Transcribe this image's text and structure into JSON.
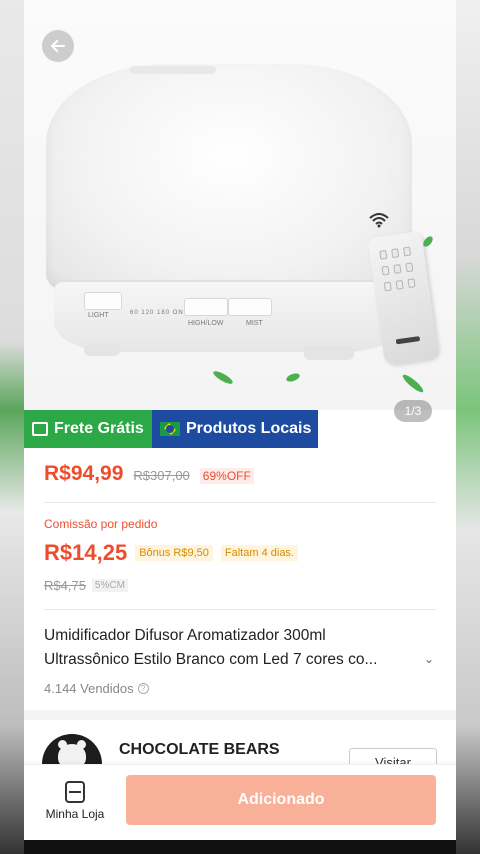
{
  "hero": {
    "back_icon": "arrow-left-icon",
    "pager": "1/3",
    "product_labels": {
      "light": "LIGHT",
      "timer": "60 120 180 ON",
      "high_low": "HIGH/LOW",
      "mist": "MIST"
    }
  },
  "badges": {
    "frete": "Frete Grátis",
    "local": "Produtos Locais"
  },
  "pricing": {
    "price": "R$94,99",
    "old_price": "R$307,00",
    "discount": "69%OFF"
  },
  "commission": {
    "label": "Comissão por pedido",
    "value": "R$14,25",
    "bonus": "Bônus R$9,50",
    "deadline": "Faltam 4 dias.",
    "old_value": "R$4,75",
    "percent": "5%CM"
  },
  "product": {
    "title_line1": "Umidificador Difusor Aromatizador 300ml",
    "title_line2": "Ultrassônico Estilo Branco com Led 7 cores co...",
    "sold": "4.144 Vendidos"
  },
  "shop": {
    "name": "CHOCOLATE BEARS",
    "visit_label": "Visitar"
  },
  "bottom_bar": {
    "store_label": "Minha Loja",
    "add_label": "Adicionado"
  },
  "colors": {
    "accent": "#ee4d2d",
    "frete_green": "#2ca847",
    "local_blue": "#1c4ba0",
    "button_disabled": "#f9a88f"
  }
}
